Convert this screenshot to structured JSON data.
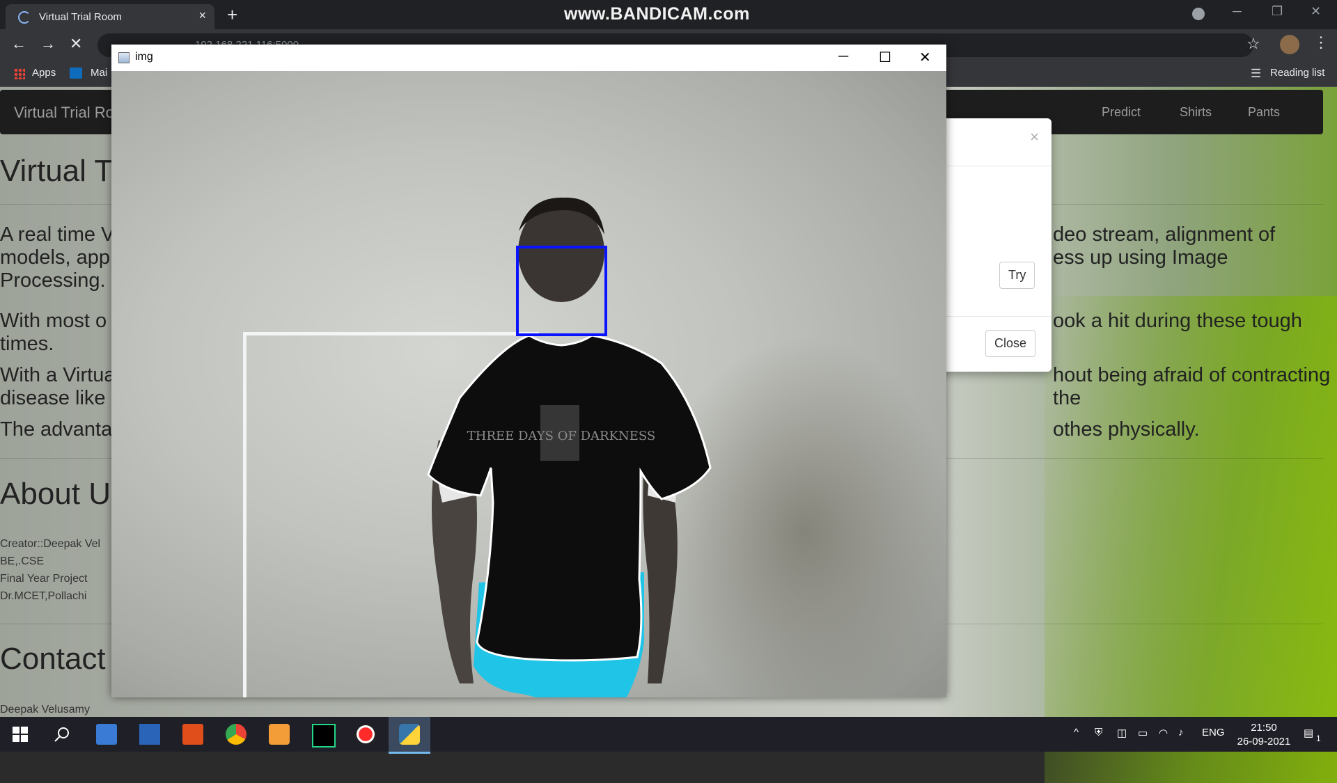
{
  "browser": {
    "tab_title": "Virtual Trial Room",
    "tab_close": "×",
    "new_tab": "+",
    "recorder_watermark": "www.BANDICAM.com",
    "win_minimize": "─",
    "win_restore": "❐",
    "win_close": "✕",
    "back": "←",
    "forward": "→",
    "stop": "✕",
    "address_text": "192.168.221.116:5000",
    "star": "☆",
    "menu": "⋮",
    "bookmarks": {
      "apps_label": "Apps",
      "mail_label": "Mai",
      "reading_list_label": "Reading list"
    }
  },
  "site": {
    "brand": "Virtual Trial Ro",
    "nav": [
      "Predict",
      "Shirts",
      "Pants"
    ],
    "heading": "Virtual T",
    "para1_left": "A real time V",
    "para1_right": "deo stream, alignment of",
    "para1_left2": "models, app",
    "para1_right2": "ess up using Image",
    "para1_left3": "Processing.",
    "para2_left": "With most o",
    "para2_right": "ook a hit during these tough",
    "para2_left2": "times.",
    "para3_left": "With a Virtua",
    "para3_right": "hout being afraid of contracting the",
    "para3_left2": "disease like",
    "para4_left": "The advanta",
    "para4_right": "othes physically.",
    "about_heading": "About U",
    "about_lines": [
      "Creator::Deepak Vel",
      "BE,.CSE",
      "Final Year Project",
      "Dr.MCET,Pollachi"
    ],
    "contact_heading": "Contact",
    "contact_name": "Deepak Velusamy"
  },
  "modal": {
    "close_x": "×",
    "try_label": "Try",
    "close_label": "Close"
  },
  "img_window": {
    "title": "img",
    "minimize": "─",
    "maximize": "☐",
    "close": "✕",
    "shirt_print": "THREE DAYS OF DARKNESS",
    "face_box_color": "#0a14ff",
    "shirt_color": "#0d0d0d",
    "pants_color": "#1fc4e6"
  },
  "taskbar": {
    "language": "ENG",
    "time": "21:50",
    "date": "26-09-2021",
    "notifications": "1"
  }
}
